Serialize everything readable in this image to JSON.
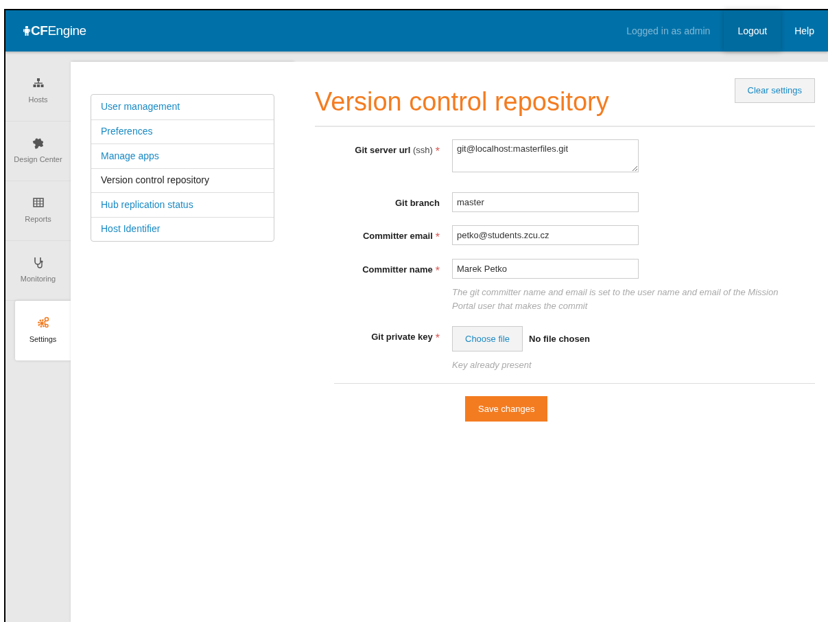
{
  "header": {
    "logo_bold": "CF",
    "logo_rest": "Engine",
    "user_text": "Logged in as admin",
    "links": [
      "Logout",
      "Help"
    ]
  },
  "nav": [
    {
      "label": "Hosts",
      "kind": "hosts",
      "selected": false
    },
    {
      "label": "Design Center",
      "kind": "design",
      "selected": false
    },
    {
      "label": "Reports",
      "kind": "reports",
      "selected": false
    },
    {
      "label": "Monitoring",
      "kind": "monitoring",
      "selected": false
    },
    {
      "label": "Settings",
      "kind": "settings",
      "selected": true
    }
  ],
  "settings_menu": [
    {
      "label": "User management",
      "selected": false
    },
    {
      "label": "Preferences",
      "selected": false
    },
    {
      "label": "Manage apps",
      "selected": false
    },
    {
      "label": "Version control repository",
      "selected": true
    },
    {
      "label": "Hub replication status",
      "selected": false
    },
    {
      "label": "Host Identifier",
      "selected": false
    }
  ],
  "page_title": "Version control repository",
  "clear_button": "Clear settings",
  "fields": [
    {
      "kind": "textarea",
      "label": "Git server url",
      "note": "(ssh)",
      "required": true,
      "value": "git@localhost:masterfiles.git"
    },
    {
      "kind": "text",
      "label": "Git branch",
      "required": false,
      "value": "master"
    },
    {
      "kind": "text",
      "label": "Committer email",
      "required": true,
      "value": "petko@students.zcu.cz"
    },
    {
      "kind": "text",
      "label": "Committer name",
      "required": true,
      "value": "Marek Petko",
      "help": "The git committer name and email is set to the user name and email of the Mission Portal user that makes the commit"
    },
    {
      "kind": "file",
      "label": "Git private key",
      "required": true,
      "button": "Choose file",
      "status": "No file chosen",
      "help": "Key already present"
    }
  ],
  "required_mark": "*",
  "save_button": "Save changes"
}
